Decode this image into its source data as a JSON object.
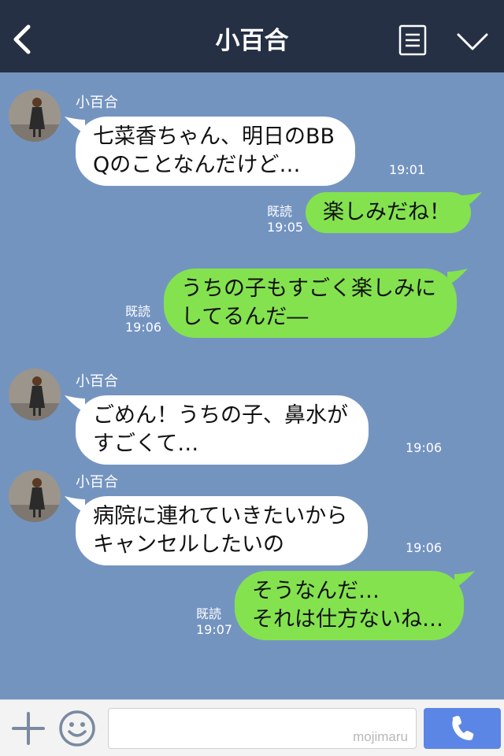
{
  "header": {
    "title": "小百合",
    "color": "#263044"
  },
  "chat": {
    "background": "#7494c0",
    "messages": [
      {
        "side": "in",
        "sender": "小百合",
        "text": "七菜香ちゃん、明日のBB\nQのことなんだけど…",
        "time": "19:01"
      },
      {
        "side": "out",
        "read": "既読",
        "text": "楽しみだね！",
        "time": "19:05"
      },
      {
        "side": "out",
        "read": "既読",
        "text": "うちの子もすごく楽しみに\nしてるんだ―",
        "time": "19:06"
      },
      {
        "side": "in",
        "sender": "小百合",
        "text": "ごめん！うちの子、鼻水が\nすごくて…",
        "time": "19:06"
      },
      {
        "side": "in",
        "sender": "小百合",
        "text": "病院に連れていきたいから\nキャンセルしたいの",
        "time": "19:06"
      },
      {
        "side": "out",
        "read": "既読",
        "text": "そうなんだ…\nそれは仕方ないね…",
        "time": "19:07"
      }
    ]
  },
  "footer": {
    "watermark": "mojimaru",
    "send_color": "#5c86e6"
  },
  "icons": [
    "chevron-left-icon",
    "menu-icon",
    "chevron-down-icon",
    "plus-icon",
    "emoji-icon",
    "phone-icon"
  ]
}
